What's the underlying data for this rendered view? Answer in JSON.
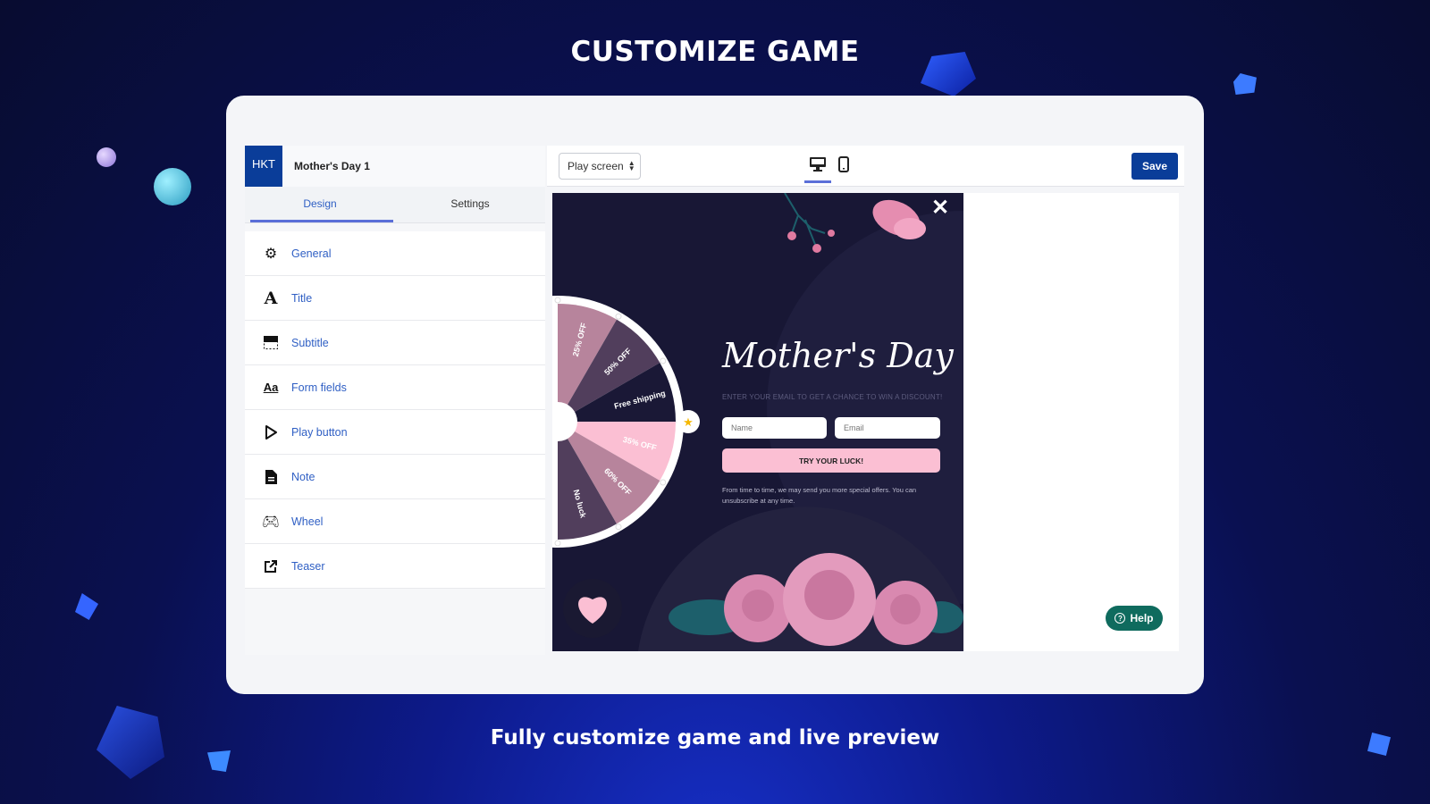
{
  "headline": "CUSTOMIZE GAME",
  "subheadline": "Fully customize game and live preview",
  "sidebar": {
    "logo": "HKT",
    "campaign_name": "Mother's Day 1",
    "tabs": [
      {
        "label": "Design",
        "active": true
      },
      {
        "label": "Settings",
        "active": false
      }
    ],
    "items": [
      {
        "label": "General",
        "icon": "gear-icon"
      },
      {
        "label": "Title",
        "icon": "font-icon"
      },
      {
        "label": "Subtitle",
        "icon": "subtitle-icon"
      },
      {
        "label": "Form fields",
        "icon": "form-fields-icon"
      },
      {
        "label": "Play button",
        "icon": "play-icon"
      },
      {
        "label": "Note",
        "icon": "document-icon"
      },
      {
        "label": "Wheel",
        "icon": "gamepad-icon"
      },
      {
        "label": "Teaser",
        "icon": "external-link-icon"
      }
    ]
  },
  "toolbar": {
    "screen_select": "Play screen",
    "active_device": "desktop",
    "save_label": "Save"
  },
  "popup": {
    "title": "Mother's Day",
    "subtitle": "Enter your email to get a chance to win a discount!",
    "name_placeholder": "Name",
    "email_placeholder": "Email",
    "button": "TRY YOUR LUCK!",
    "note": "From time to time, we may send you more special offers. You can unsubscribe at any time.",
    "wheel_segments": [
      {
        "label": "25% OFF",
        "color": "#b7849c"
      },
      {
        "label": "50% OFF",
        "color": "#513e5c"
      },
      {
        "label": "Free shipping",
        "color": "#1a1836"
      },
      {
        "label": "35% OFF",
        "color": "#fbbfd3"
      },
      {
        "label": "60% OFF",
        "color": "#b7849c"
      },
      {
        "label": "No luck",
        "color": "#513e5c"
      }
    ]
  },
  "help_label": "Help",
  "colors": {
    "brand": "#0a3d99",
    "accent": "#2f5fc4",
    "help": "#0f6b5e",
    "popup_bg": "#181735",
    "button": "#fbbfd3"
  }
}
